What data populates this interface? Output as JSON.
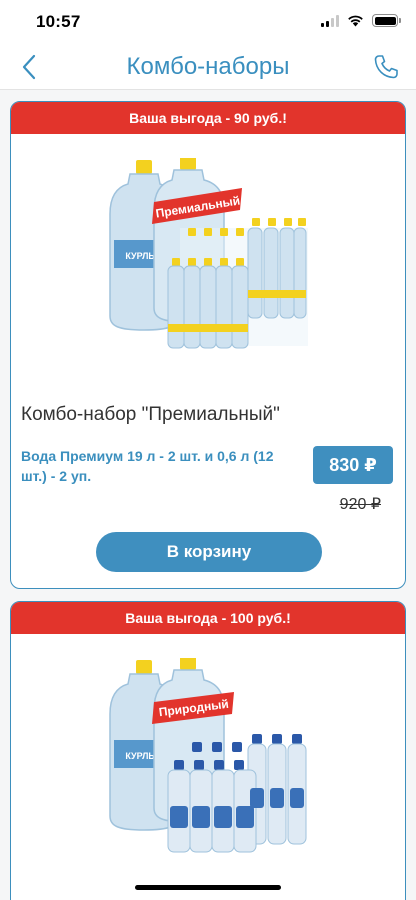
{
  "status_bar": {
    "time": "10:57"
  },
  "nav": {
    "title": "Комбо-наборы",
    "back_icon": "chevron-left-icon",
    "phone_icon": "phone-icon"
  },
  "colors": {
    "accent": "#3f8fbf",
    "banner": "#e2342c",
    "text": "#333333"
  },
  "products": [
    {
      "banner": "Ваша выгода - 90 руб.!",
      "image_ribbon": "Премиальный",
      "title": "Комбо-набор \"Премиальный\"",
      "description": "Вода Премиум 19 л - 2 шт. и 0,6 л (12 шт.) - 2 уп.",
      "price": "830 ₽",
      "old_price": "920 ₽",
      "button_label": "В корзину"
    },
    {
      "banner": "Ваша выгода - 100 руб.!",
      "image_ribbon": "Природный"
    }
  ]
}
